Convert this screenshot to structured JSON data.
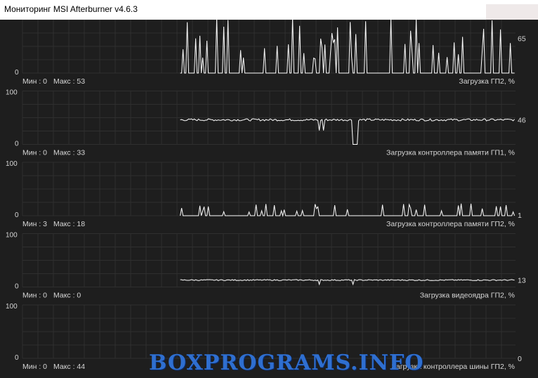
{
  "window": {
    "title": "Мониторинг MSI Afterburner v4.6.3",
    "watermark": "BOXPROGRAMS.INFO"
  },
  "colors": {
    "background": "#1e1e1e",
    "grid": "#2f2f2f",
    "line": "#ffffff",
    "text": "#d6d6d6"
  },
  "graphs": [
    {
      "label": "Загрузка ГП2, %",
      "min_text": "Мин : 0",
      "max_text": "Макс : 53",
      "top_label": "",
      "bottom_label": "0",
      "current": "65",
      "current_level": 0.65,
      "pattern": "spikes-high",
      "data_start": 0.32
    },
    {
      "label": "Загрузка контроллера памяти ГП1, %",
      "min_text": "Мин : 0",
      "max_text": "Макс : 33",
      "top_label": "100",
      "bottom_label": "0",
      "current": "46",
      "current_level": 0.46,
      "pattern": "flat-dips",
      "data_start": 0.32
    },
    {
      "label": "Загрузка контроллера памяти ГП2, %",
      "min_text": "Мин : 3",
      "max_text": "Макс : 18",
      "top_label": "100",
      "bottom_label": "0",
      "current": "1",
      "current_level": 0.01,
      "pattern": "spikes-low",
      "data_start": 0.32
    },
    {
      "label": "Загрузка видеоядра ГП2, %",
      "min_text": "Мин : 0",
      "max_text": "Макс : 0",
      "top_label": "100",
      "bottom_label": "0",
      "current": "13",
      "current_level": 0.13,
      "pattern": "flat-dips-small",
      "data_start": 0.32
    },
    {
      "label": "Загрузка контроллера шины ГП2, %",
      "min_text": "Мин : 0",
      "max_text": "Макс : 44",
      "top_label": "100",
      "bottom_label": "0",
      "current": "0",
      "current_level": 0.0,
      "pattern": "empty",
      "data_start": 1.0
    }
  ]
}
